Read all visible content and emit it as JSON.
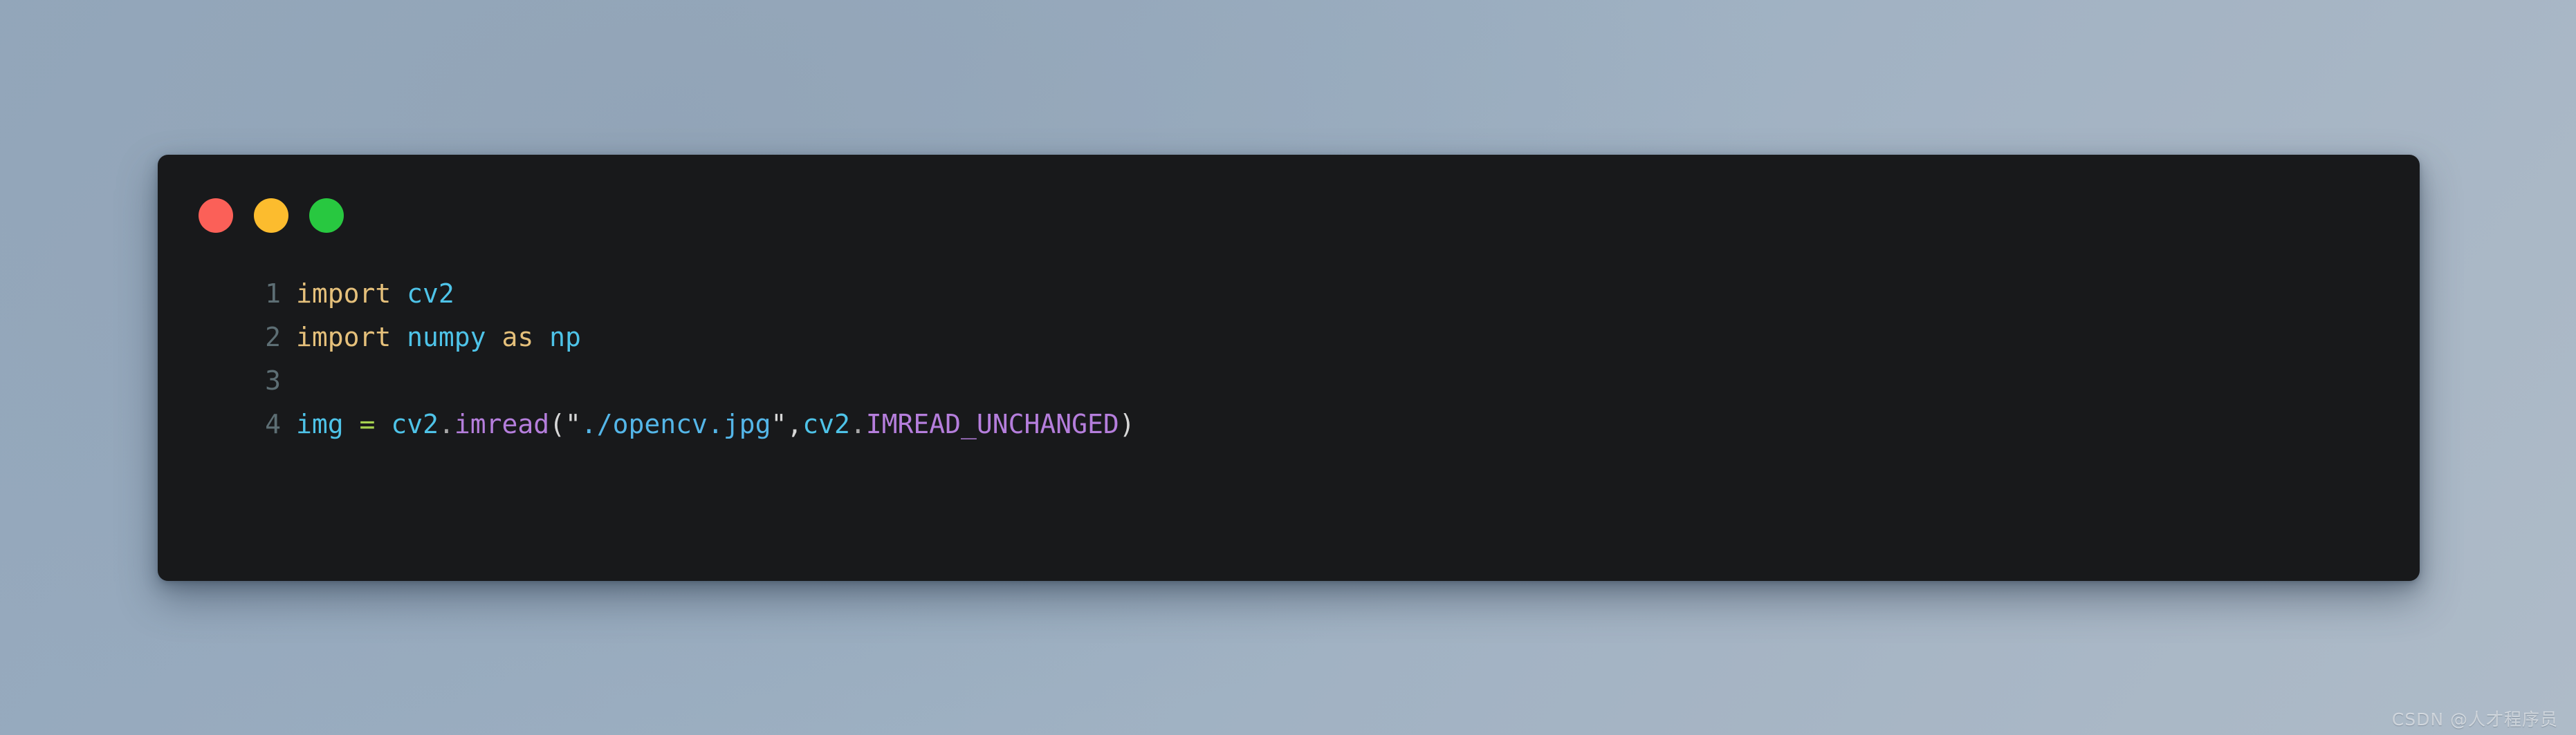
{
  "window": {
    "background_color_start": "#93a7bb",
    "background_color_end": "#aebbc8",
    "card_background": "#18191b"
  },
  "window_controls": {
    "close": {
      "name": "close",
      "color": "#fb6058"
    },
    "minimize": {
      "name": "minimize",
      "color": "#fcbc2e"
    },
    "maximize": {
      "name": "maximize",
      "color": "#28c840"
    }
  },
  "editor": {
    "language": "python",
    "line_numbers": [
      "1",
      "2",
      "3",
      "4"
    ],
    "lines": [
      {
        "number": "1",
        "tokens": [
          {
            "text": "import",
            "kind": "keyword"
          },
          {
            "text": " ",
            "kind": "punct"
          },
          {
            "text": "cv2",
            "kind": "module"
          }
        ]
      },
      {
        "number": "2",
        "tokens": [
          {
            "text": "import",
            "kind": "keyword"
          },
          {
            "text": " ",
            "kind": "punct"
          },
          {
            "text": "numpy",
            "kind": "module"
          },
          {
            "text": " ",
            "kind": "punct"
          },
          {
            "text": "as",
            "kind": "keyword"
          },
          {
            "text": " ",
            "kind": "punct"
          },
          {
            "text": "np",
            "kind": "module"
          }
        ]
      },
      {
        "number": "3",
        "tokens": []
      },
      {
        "number": "4",
        "tokens": [
          {
            "text": "img",
            "kind": "var"
          },
          {
            "text": " ",
            "kind": "punct"
          },
          {
            "text": "=",
            "kind": "operator"
          },
          {
            "text": " ",
            "kind": "punct"
          },
          {
            "text": "cv2",
            "kind": "module"
          },
          {
            "text": ".",
            "kind": "dot"
          },
          {
            "text": "imread",
            "kind": "func"
          },
          {
            "text": "(",
            "kind": "punct"
          },
          {
            "text": "\"",
            "kind": "quote"
          },
          {
            "text": "./opencv.jpg",
            "kind": "string"
          },
          {
            "text": "\"",
            "kind": "quote"
          },
          {
            "text": ",",
            "kind": "punct"
          },
          {
            "text": "cv2",
            "kind": "module"
          },
          {
            "text": ".",
            "kind": "dot"
          },
          {
            "text": "IMREAD_UNCHANGED",
            "kind": "const"
          },
          {
            "text": ")",
            "kind": "punct"
          }
        ]
      }
    ],
    "plain_text": "import cv2\nimport numpy as np\n\nimg = cv2.imread(\"./opencv.jpg\",cv2.IMREAD_UNCHANGED)",
    "colors": {
      "line_number": "#5d6e74",
      "keyword": "#e5c07b",
      "module": "#4ec3e8",
      "function": "#b57edc",
      "constant": "#b57edc",
      "string": "#54b6e8",
      "operator": "#a6d24f",
      "punctuation": "#d7d7d7"
    }
  },
  "watermark": {
    "text": "CSDN @人才程序员"
  }
}
